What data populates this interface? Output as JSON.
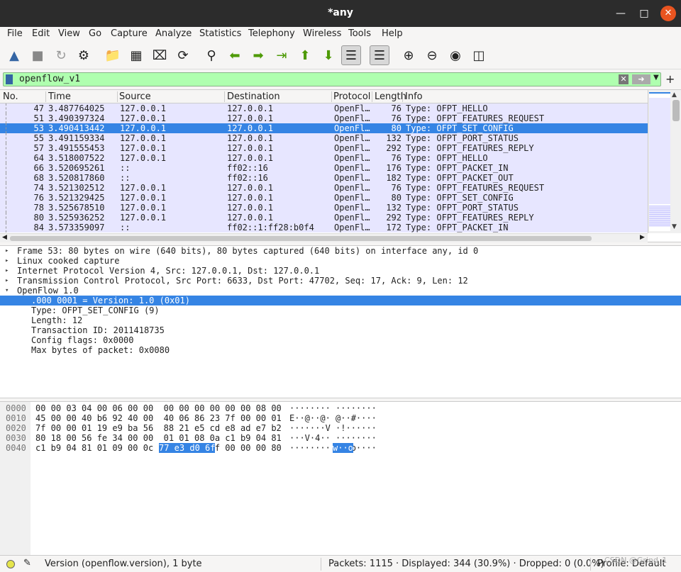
{
  "window": {
    "title": "*any",
    "min_icon": "minimize-icon",
    "max_icon": "maximize-icon",
    "close_icon": "close-icon"
  },
  "menu": [
    "File",
    "Edit",
    "View",
    "Go",
    "Capture",
    "Analyze",
    "Statistics",
    "Telephony",
    "Wireless",
    "Tools",
    "Help"
  ],
  "filter": {
    "value": "openflow_v1",
    "clear_icon": "clear-icon",
    "apply_icon": "apply-arrow-icon",
    "dropdown_icon": "chevron-down-icon",
    "add_icon": "plus-icon"
  },
  "columns": [
    "No.",
    "Time",
    "Source",
    "Destination",
    "Protocol",
    "Length",
    "Info"
  ],
  "packets": [
    {
      "no": "47",
      "time": "3.487764025",
      "src": "127.0.0.1",
      "dst": "127.0.0.1",
      "proto": "OpenFl…",
      "len": "76",
      "info": "Type: OFPT_HELLO"
    },
    {
      "no": "51",
      "time": "3.490397324",
      "src": "127.0.0.1",
      "dst": "127.0.0.1",
      "proto": "OpenFl…",
      "len": "76",
      "info": "Type: OFPT_FEATURES_REQUEST"
    },
    {
      "no": "53",
      "time": "3.490413442",
      "src": "127.0.0.1",
      "dst": "127.0.0.1",
      "proto": "OpenFl…",
      "len": "80",
      "info": "Type: OFPT_SET_CONFIG"
    },
    {
      "no": "55",
      "time": "3.491159334",
      "src": "127.0.0.1",
      "dst": "127.0.0.1",
      "proto": "OpenFl…",
      "len": "132",
      "info": "Type: OFPT_PORT_STATUS"
    },
    {
      "no": "57",
      "time": "3.491555453",
      "src": "127.0.0.1",
      "dst": "127.0.0.1",
      "proto": "OpenFl…",
      "len": "292",
      "info": "Type: OFPT_FEATURES_REPLY"
    },
    {
      "no": "64",
      "time": "3.518007522",
      "src": "127.0.0.1",
      "dst": "127.0.0.1",
      "proto": "OpenFl…",
      "len": "76",
      "info": "Type: OFPT_HELLO"
    },
    {
      "no": "66",
      "time": "3.520695261",
      "src": "::",
      "dst": "ff02::16",
      "proto": "OpenFl…",
      "len": "176",
      "info": "Type: OFPT_PACKET_IN"
    },
    {
      "no": "68",
      "time": "3.520817860",
      "src": "::",
      "dst": "ff02::16",
      "proto": "OpenFl…",
      "len": "182",
      "info": "Type: OFPT_PACKET_OUT"
    },
    {
      "no": "74",
      "time": "3.521302512",
      "src": "127.0.0.1",
      "dst": "127.0.0.1",
      "proto": "OpenFl…",
      "len": "76",
      "info": "Type: OFPT_FEATURES_REQUEST"
    },
    {
      "no": "76",
      "time": "3.521329425",
      "src": "127.0.0.1",
      "dst": "127.0.0.1",
      "proto": "OpenFl…",
      "len": "80",
      "info": "Type: OFPT_SET_CONFIG"
    },
    {
      "no": "78",
      "time": "3.525678510",
      "src": "127.0.0.1",
      "dst": "127.0.0.1",
      "proto": "OpenFl…",
      "len": "132",
      "info": "Type: OFPT_PORT_STATUS"
    },
    {
      "no": "80",
      "time": "3.525936252",
      "src": "127.0.0.1",
      "dst": "127.0.0.1",
      "proto": "OpenFl…",
      "len": "292",
      "info": "Type: OFPT_FEATURES_REPLY"
    },
    {
      "no": "84",
      "time": "3.573359097",
      "src": "::",
      "dst": "ff02::1:ff28:b0f4",
      "proto": "OpenFl…",
      "len": "172",
      "info": "Type: OFPT_PACKET_IN"
    }
  ],
  "selected_packet_index": 2,
  "details": [
    {
      "text": "Frame 53: 80 bytes on wire (640 bits), 80 bytes captured (640 bits) on interface any, id 0",
      "tw": "▸"
    },
    {
      "text": "Linux cooked capture",
      "tw": "▸"
    },
    {
      "text": "Internet Protocol Version 4, Src: 127.0.0.1, Dst: 127.0.0.1",
      "tw": "▸"
    },
    {
      "text": "Transmission Control Protocol, Src Port: 6633, Dst Port: 47702, Seq: 17, Ack: 9, Len: 12",
      "tw": "▸"
    },
    {
      "text": "OpenFlow 1.0",
      "tw": "▾"
    },
    {
      "text": ".000 0001 = Version: 1.0 (0x01)",
      "tw": "",
      "sel": true
    },
    {
      "text": "Type: OFPT_SET_CONFIG (9)",
      "tw": ""
    },
    {
      "text": "Length: 12",
      "tw": ""
    },
    {
      "text": "Transaction ID: 2011418735",
      "tw": ""
    },
    {
      "text": "Config flags: 0x0000",
      "tw": ""
    },
    {
      "text": "Max bytes of packet: 0x0080",
      "tw": ""
    }
  ],
  "hex": [
    {
      "off": "0000",
      "hex": "00 00 03 04 00 06 00 00  00 00 00 00 00 00 08 00",
      "ascii": "········ ········"
    },
    {
      "off": "0010",
      "hex": "45 00 00 40 b6 92 40 00  40 06 86 23 7f 00 00 01",
      "ascii": "E··@··@· @··#····"
    },
    {
      "off": "0020",
      "hex": "7f 00 00 01 19 e9 ba 56  88 21 e5 cd e8 ad e7 b2",
      "ascii": "·······V ·!······"
    },
    {
      "off": "0030",
      "hex": "80 18 00 56 fe 34 00 00  01 01 08 0a c1 b9 04 81",
      "ascii": "···V·4·· ········"
    },
    {
      "off": "0040",
      "hex": "c1 b9 04 81 01 09 00 0c  77 e3 d0 6f 00 00 00 80",
      "ascii": "········ w··o····"
    }
  ],
  "hex_highlight": {
    "hex": "77 e3 d0 6f",
    "ascii": "w··o"
  },
  "status": {
    "field": "Version (openflow.version), 1 byte",
    "stats": "Packets: 1115 · Displayed: 344 (30.9%) · Dropped: 0 (0.0%)",
    "profile": "Profile: Default",
    "watermark": "CSDN @Grind_1"
  },
  "colors": {
    "selection": "#3584e4",
    "row_bg": "#e7e6ff",
    "filter_valid": "#afffaf",
    "close_btn": "#e95420"
  }
}
